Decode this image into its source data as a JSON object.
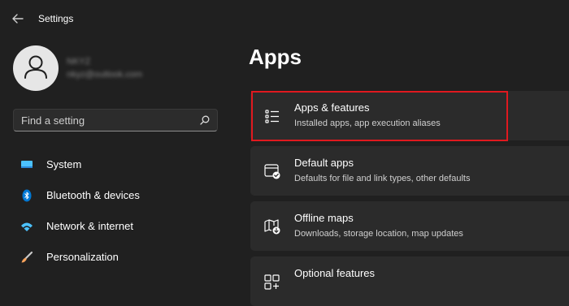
{
  "window": {
    "title": "Settings"
  },
  "user": {
    "name": "NKYZ",
    "email": "nkyz@outlook.com"
  },
  "search": {
    "placeholder": "Find a setting"
  },
  "sidebar": {
    "items": [
      {
        "label": "System",
        "icon": "system-icon",
        "color": "#4cc2ff"
      },
      {
        "label": "Bluetooth & devices",
        "icon": "bluetooth-icon",
        "color": "#0078d4"
      },
      {
        "label": "Network & internet",
        "icon": "wifi-icon",
        "color": "#4cc2ff"
      },
      {
        "label": "Personalization",
        "icon": "paintbrush-icon",
        "color": "#f7a35c"
      }
    ]
  },
  "main": {
    "title": "Apps",
    "cards": [
      {
        "title": "Apps & features",
        "subtitle": "Installed apps, app execution aliases",
        "icon": "apps-features-icon",
        "highlighted": true
      },
      {
        "title": "Default apps",
        "subtitle": "Defaults for file and link types, other defaults",
        "icon": "default-apps-icon"
      },
      {
        "title": "Offline maps",
        "subtitle": "Downloads, storage location, map updates",
        "icon": "offline-maps-icon"
      },
      {
        "title": "Optional features",
        "subtitle": "",
        "icon": "optional-features-icon"
      }
    ]
  },
  "colors": {
    "background": "#202020",
    "card": "#2b2b2b",
    "highlight": "#e0191f",
    "accent": "#4cc2ff"
  }
}
